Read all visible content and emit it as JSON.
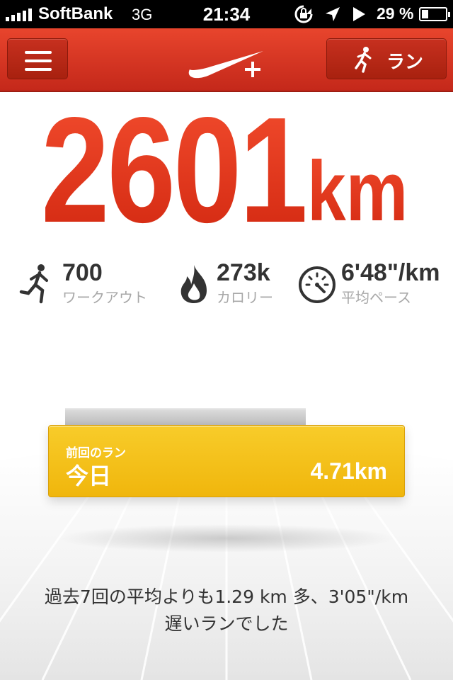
{
  "status_bar": {
    "carrier": "SoftBank",
    "network": "3G",
    "time": "21:34",
    "battery_percent": "29 %",
    "icons": [
      "signal-icon",
      "rotation-lock-icon",
      "location-icon",
      "play-icon",
      "battery-icon"
    ]
  },
  "header": {
    "menu_icon": "hamburger-icon",
    "logo": "nike-plus-logo",
    "run_button_label": "ラン",
    "run_icon": "runner-icon"
  },
  "total": {
    "distance": "2601",
    "unit": "km"
  },
  "stats": {
    "workouts": {
      "value": "700",
      "label": "ワークアウト",
      "icon": "runner-icon"
    },
    "calories": {
      "value": "273k",
      "label": "カロリー",
      "icon": "flame-icon"
    },
    "pace": {
      "value": "6'48\"/km",
      "label": "平均ペース",
      "icon": "speedometer-icon"
    }
  },
  "last_run": {
    "caption": "前回のラン",
    "day": "今日",
    "distance": "4.71km"
  },
  "summary": {
    "line1": "過去7回の平均よりも1.29 km 多、3'05\"/km",
    "line2": "遅いランでした"
  },
  "colors": {
    "accent_red": "#e0331c",
    "card_yellow": "#f4c01a",
    "header_red": "#d43520"
  }
}
